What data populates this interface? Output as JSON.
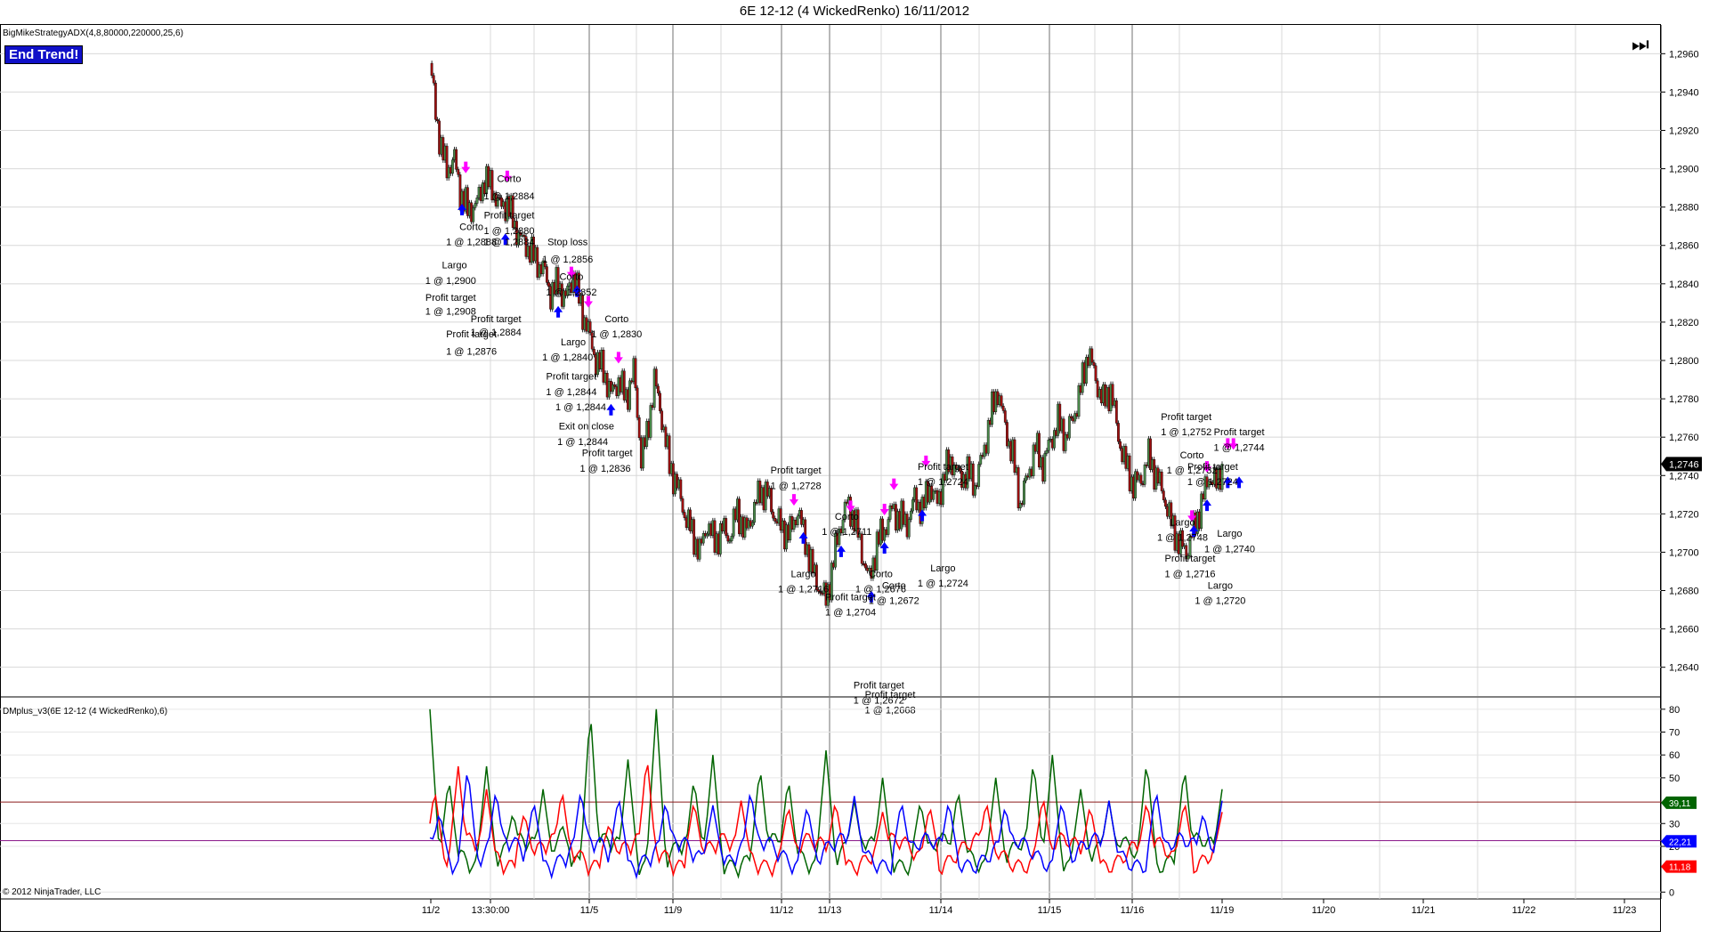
{
  "window": {
    "title": "6E 12-12 (4 WickedRenko)  16/11/2012",
    "indicator_label": "BigMikeStrategyADX(4,8,80000,220000,25,6)",
    "end_trend_label": "End Trend!",
    "dm_label": "DMplus_v3(6E 12-12 (4 WickedRenko),6)",
    "copyright": "© 2012 NinjaTrader, LLC",
    "end_icon": "skip-to-end-icon"
  },
  "chart_data": [
    {
      "type": "candlestick",
      "title": "",
      "ylim": [
        1.2625,
        1.2975
      ],
      "y_ticks": [
        "1,2960",
        "1,2940",
        "1,2920",
        "1,2900",
        "1,2880",
        "1,2860",
        "1,2840",
        "1,2820",
        "1,2800",
        "1,2780",
        "1,2760",
        "1,2740",
        "1,2720",
        "1,2700",
        "1,2680",
        "1,2660",
        "1,2640"
      ],
      "y_tick_values": [
        1.296,
        1.294,
        1.292,
        1.29,
        1.288,
        1.286,
        1.284,
        1.282,
        1.28,
        1.278,
        1.276,
        1.274,
        1.272,
        1.27,
        1.268,
        1.266,
        1.264
      ],
      "current_price_label": "1,2746",
      "current_price": 1.2746,
      "colors": {
        "up": "#4a8a4a",
        "down": "#a01010",
        "wick": "#000000",
        "long_arrow": "#0000ff",
        "short_arrow": "#ff00ff",
        "grid": "#d8d8d8",
        "session_line": "#a0a0a0"
      },
      "close_path": [
        [
          0,
          1.2955
        ],
        [
          6,
          1.293
        ],
        [
          12,
          1.291
        ],
        [
          18,
          1.29
        ],
        [
          26,
          1.2905
        ],
        [
          32,
          1.2888
        ],
        [
          40,
          1.2878
        ],
        [
          50,
          1.2882
        ],
        [
          58,
          1.2895
        ],
        [
          66,
          1.289
        ],
        [
          74,
          1.288
        ],
        [
          82,
          1.2882
        ],
        [
          90,
          1.287
        ],
        [
          98,
          1.2862
        ],
        [
          106,
          1.2858
        ],
        [
          112,
          1.2852
        ],
        [
          120,
          1.2848
        ],
        [
          128,
          1.2835
        ],
        [
          136,
          1.284
        ],
        [
          144,
          1.2832
        ],
        [
          152,
          1.2845
        ],
        [
          160,
          1.2828
        ],
        [
          168,
          1.2815
        ],
        [
          176,
          1.28
        ],
        [
          184,
          1.2795
        ],
        [
          192,
          1.2782
        ],
        [
          200,
          1.279
        ],
        [
          208,
          1.278
        ],
        [
          216,
          1.2795
        ],
        [
          224,
          1.275
        ],
        [
          230,
          1.276
        ],
        [
          238,
          1.279
        ],
        [
          246,
          1.277
        ],
        [
          254,
          1.2745
        ],
        [
          262,
          1.2735
        ],
        [
          270,
          1.272
        ],
        [
          278,
          1.271
        ],
        [
          286,
          1.27
        ],
        [
          294,
          1.2715
        ],
        [
          302,
          1.2705
        ],
        [
          310,
          1.2712
        ],
        [
          318,
          1.2708
        ],
        [
          326,
          1.2722
        ],
        [
          334,
          1.271
        ],
        [
          342,
          1.272
        ],
        [
          350,
          1.2732
        ],
        [
          358,
          1.273
        ],
        [
          366,
          1.2718
        ],
        [
          374,
          1.2712
        ],
        [
          382,
          1.271
        ],
        [
          390,
          1.2722
        ],
        [
          398,
          1.2706
        ],
        [
          406,
          1.269
        ],
        [
          414,
          1.268
        ],
        [
          420,
          1.2675
        ],
        [
          426,
          1.269
        ],
        [
          434,
          1.2712
        ],
        [
          442,
          1.2725
        ],
        [
          450,
          1.2718
        ],
        [
          458,
          1.27
        ],
        [
          466,
          1.2685
        ],
        [
          474,
          1.2705
        ],
        [
          482,
          1.2712
        ],
        [
          490,
          1.2722
        ],
        [
          498,
          1.2718
        ],
        [
          506,
          1.2715
        ],
        [
          514,
          1.2728
        ],
        [
          522,
          1.2722
        ],
        [
          530,
          1.2735
        ],
        [
          538,
          1.2725
        ],
        [
          546,
          1.2742
        ],
        [
          554,
          1.2748
        ],
        [
          562,
          1.2738
        ],
        [
          570,
          1.2742
        ],
        [
          578,
          1.2735
        ],
        [
          586,
          1.275
        ],
        [
          594,
          1.277
        ],
        [
          602,
          1.2785
        ],
        [
          610,
          1.2765
        ],
        [
          618,
          1.275
        ],
        [
          626,
          1.2725
        ],
        [
          634,
          1.274
        ],
        [
          642,
          1.2755
        ],
        [
          650,
          1.2745
        ],
        [
          658,
          1.2758
        ],
        [
          666,
          1.2768
        ],
        [
          674,
          1.276
        ],
        [
          682,
          1.277
        ],
        [
          690,
          1.2785
        ],
        [
          698,
          1.2805
        ],
        [
          706,
          1.279
        ],
        [
          714,
          1.2778
        ],
        [
          722,
          1.2785
        ],
        [
          730,
          1.276
        ],
        [
          738,
          1.2745
        ],
        [
          746,
          1.2735
        ],
        [
          754,
          1.2738
        ],
        [
          762,
          1.275
        ],
        [
          770,
          1.274
        ],
        [
          778,
          1.273
        ],
        [
          786,
          1.2715
        ],
        [
          794,
          1.2705
        ],
        [
          802,
          1.27
        ],
        [
          810,
          1.2712
        ],
        [
          818,
          1.2725
        ],
        [
          826,
          1.274
        ],
        [
          834,
          1.2735
        ],
        [
          840,
          1.2746
        ]
      ],
      "x_ticks": [
        "11/2",
        "13:30:00",
        "11/5",
        "11/9",
        "11/12",
        "11/13",
        "11/14",
        "11/15",
        "11/16",
        "11/19",
        "11/20",
        "11/21",
        "11/22",
        "11/23"
      ],
      "annotations": [
        {
          "text": "Corto",
          "x": 84,
          "price": 1.2893
        },
        {
          "text": "1 @ 1,2884",
          "x": 84,
          "price": 1.2884
        },
        {
          "text": "Profit target",
          "x": 84,
          "price": 1.2874
        },
        {
          "text": "1 @ 1,2880",
          "x": 84,
          "price": 1.2866
        },
        {
          "text": "1 @ 1,2884",
          "x": 84,
          "price": 1.286
        },
        {
          "text": "Corto",
          "x": 44,
          "price": 1.2868
        },
        {
          "text": "1 @ 1,2888",
          "x": 44,
          "price": 1.286
        },
        {
          "text": "Largo",
          "x": 26,
          "price": 1.2848
        },
        {
          "text": "1 @ 1,2900",
          "x": 22,
          "price": 1.284
        },
        {
          "text": "Profit target",
          "x": 22,
          "price": 1.2831
        },
        {
          "text": "1 @ 1,2908",
          "x": 22,
          "price": 1.2824
        },
        {
          "text": "Profit target",
          "x": 70,
          "price": 1.282
        },
        {
          "text": "1 @ 1,2884",
          "x": 70,
          "price": 1.2813
        },
        {
          "text": "Profit target",
          "x": 44,
          "price": 1.2812
        },
        {
          "text": "1 @ 1,2876",
          "x": 44,
          "price": 1.2803
        },
        {
          "text": "Stop loss",
          "x": 146,
          "price": 1.286
        },
        {
          "text": "1 @ 1,2856",
          "x": 146,
          "price": 1.2851
        },
        {
          "text": "Corto",
          "x": 150,
          "price": 1.2842
        },
        {
          "text": "1 @ 1,2852",
          "x": 150,
          "price": 1.2834
        },
        {
          "text": "Corto",
          "x": 198,
          "price": 1.282
        },
        {
          "text": "1 @ 1,2830",
          "x": 198,
          "price": 1.2812
        },
        {
          "text": "Largo",
          "x": 152,
          "price": 1.2808
        },
        {
          "text": "1 @ 1,2840",
          "x": 146,
          "price": 1.28
        },
        {
          "text": "Profit target",
          "x": 150,
          "price": 1.279
        },
        {
          "text": "1 @ 1,2844",
          "x": 150,
          "price": 1.2782
        },
        {
          "text": "1 @ 1,2844",
          "x": 160,
          "price": 1.2774
        },
        {
          "text": "Exit on close",
          "x": 166,
          "price": 1.2764
        },
        {
          "text": "1 @ 1,2844",
          "x": 162,
          "price": 1.2756
        },
        {
          "text": "Profit target",
          "x": 188,
          "price": 1.275
        },
        {
          "text": "1 @ 1,2836",
          "x": 186,
          "price": 1.2742
        },
        {
          "text": "Profit target",
          "x": 388,
          "price": 1.2741
        },
        {
          "text": "1 @ 1,2728",
          "x": 388,
          "price": 1.2733
        },
        {
          "text": "Corto",
          "x": 442,
          "price": 1.2717
        },
        {
          "text": "1 @ 1,2711",
          "x": 442,
          "price": 1.2709
        },
        {
          "text": "Largo",
          "x": 396,
          "price": 1.2687
        },
        {
          "text": "1 @ 1,2716",
          "x": 396,
          "price": 1.2679
        },
        {
          "text": "Profit target",
          "x": 544,
          "price": 1.2743
        },
        {
          "text": "1 @ 1,2724",
          "x": 544,
          "price": 1.2735
        },
        {
          "text": "Largo",
          "x": 544,
          "price": 1.269
        },
        {
          "text": "1 @ 1,2724",
          "x": 544,
          "price": 1.2682
        },
        {
          "text": "Corto",
          "x": 478,
          "price": 1.2687
        },
        {
          "text": "1 @ 1,2676",
          "x": 478,
          "price": 1.2679
        },
        {
          "text": "Corto",
          "x": 492,
          "price": 1.2681
        },
        {
          "text": "1 @ 1,2672",
          "x": 492,
          "price": 1.2673
        },
        {
          "text": "Profit target",
          "x": 446,
          "price": 1.2675
        },
        {
          "text": "1 @ 1,2704",
          "x": 446,
          "price": 1.2667
        },
        {
          "text": "Profit target",
          "x": 476,
          "price": 1.2629
        },
        {
          "text": "1 @ 1,2672",
          "x": 476,
          "price": 1.2621
        },
        {
          "text": "Profit target",
          "x": 488,
          "price": 1.2624
        },
        {
          "text": "1 @ 1,2668",
          "x": 488,
          "price": 1.2616
        },
        {
          "text": "Profit target",
          "x": 802,
          "price": 1.2769
        },
        {
          "text": "1 @ 1,2752",
          "x": 802,
          "price": 1.2761
        },
        {
          "text": "Profit target",
          "x": 858,
          "price": 1.2761
        },
        {
          "text": "1 @ 1,2744",
          "x": 858,
          "price": 1.2753
        },
        {
          "text": "Corto",
          "x": 808,
          "price": 1.2749
        },
        {
          "text": "1 @ 1,2732",
          "x": 808,
          "price": 1.2741
        },
        {
          "text": "Profit target",
          "x": 830,
          "price": 1.2743
        },
        {
          "text": "1 @ 1,2724",
          "x": 830,
          "price": 1.2735
        },
        {
          "text": "Largo",
          "x": 798,
          "price": 1.2714
        },
        {
          "text": "1 @ 1,2748",
          "x": 798,
          "price": 1.2706
        },
        {
          "text": "Largo",
          "x": 848,
          "price": 1.2708
        },
        {
          "text": "1 @ 1,2740",
          "x": 848,
          "price": 1.27
        },
        {
          "text": "Profit target",
          "x": 806,
          "price": 1.2695
        },
        {
          "text": "1 @ 1,2716",
          "x": 806,
          "price": 1.2687
        },
        {
          "text": "Largo",
          "x": 838,
          "price": 1.2681
        },
        {
          "text": "1 @ 1,2720",
          "x": 838,
          "price": 1.2673
        }
      ],
      "long_arrows_x": [
        34,
        80,
        136,
        156,
        192,
        396,
        436,
        468,
        482,
        522,
        810,
        824,
        846,
        858
      ],
      "short_arrows_x": [
        38,
        82,
        150,
        168,
        200,
        386,
        446,
        482,
        492,
        526,
        808,
        824,
        846,
        852
      ]
    },
    {
      "type": "line",
      "title": "",
      "ylim": [
        -3,
        85
      ],
      "y_ticks": [
        "80",
        "70",
        "60",
        "50",
        "30",
        "20",
        "0"
      ],
      "y_tick_values": [
        80,
        70,
        60,
        50,
        30,
        20,
        0
      ],
      "h_lines": [
        {
          "value": 39.11,
          "label": "39,11",
          "color": "#006400"
        },
        {
          "value": 22.21,
          "label": "22,21",
          "color": "#0000ff"
        },
        {
          "value": 11.18,
          "label": "11,18",
          "color": "#ff0000"
        }
      ],
      "threshold_lines": [
        {
          "value": 39.4,
          "color": "#8b1a1a"
        },
        {
          "value": 22.5,
          "color": "#8b1a8b"
        }
      ],
      "series": [
        {
          "color": "#006400",
          "peaks": [
            [
              0,
              80
            ],
            [
              20,
              50
            ],
            [
              60,
              55
            ],
            [
              88,
              35
            ],
            [
              120,
              45
            ],
            [
              140,
              30
            ],
            [
              170,
              80
            ],
            [
              210,
              58
            ],
            [
              240,
              80
            ],
            [
              280,
              50
            ],
            [
              300,
              60
            ],
            [
              350,
              55
            ],
            [
              380,
              50
            ],
            [
              420,
              62
            ],
            [
              450,
              40
            ],
            [
              480,
              50
            ],
            [
              520,
              40
            ],
            [
              560,
              45
            ],
            [
              600,
              50
            ],
            [
              640,
              58
            ],
            [
              660,
              60
            ],
            [
              690,
              45
            ],
            [
              720,
              40
            ],
            [
              760,
              58
            ],
            [
              800,
              55
            ],
            [
              840,
              45
            ]
          ]
        },
        {
          "color": "#ff0000",
          "peaks": [
            [
              5,
              45
            ],
            [
              30,
              55
            ],
            [
              60,
              45
            ],
            [
              100,
              35
            ],
            [
              140,
              45
            ],
            [
              190,
              30
            ],
            [
              230,
              60
            ],
            [
              280,
              40
            ],
            [
              330,
              40
            ],
            [
              380,
              38
            ],
            [
              430,
              40
            ],
            [
              480,
              35
            ],
            [
              530,
              38
            ],
            [
              590,
              40
            ],
            [
              650,
              42
            ],
            [
              700,
              38
            ],
            [
              760,
              40
            ],
            [
              800,
              40
            ],
            [
              840,
              35
            ]
          ]
        },
        {
          "color": "#0000ff",
          "peaks": [
            [
              10,
              35
            ],
            [
              40,
              55
            ],
            [
              70,
              45
            ],
            [
              110,
              40
            ],
            [
              160,
              45
            ],
            [
              200,
              42
            ],
            [
              250,
              40
            ],
            [
              300,
              38
            ],
            [
              340,
              45
            ],
            [
              400,
              38
            ],
            [
              450,
              42
            ],
            [
              500,
              40
            ],
            [
              550,
              40
            ],
            [
              610,
              38
            ],
            [
              670,
              40
            ],
            [
              720,
              40
            ],
            [
              770,
              45
            ],
            [
              820,
              35
            ],
            [
              840,
              40
            ]
          ]
        }
      ],
      "x_ticks": [
        "11/2",
        "13:30:00",
        "11/5",
        "11/9",
        "11/12",
        "11/13",
        "11/14",
        "11/15",
        "11/16",
        "11/19",
        "11/20",
        "11/21",
        "11/22",
        "11/23"
      ]
    }
  ]
}
